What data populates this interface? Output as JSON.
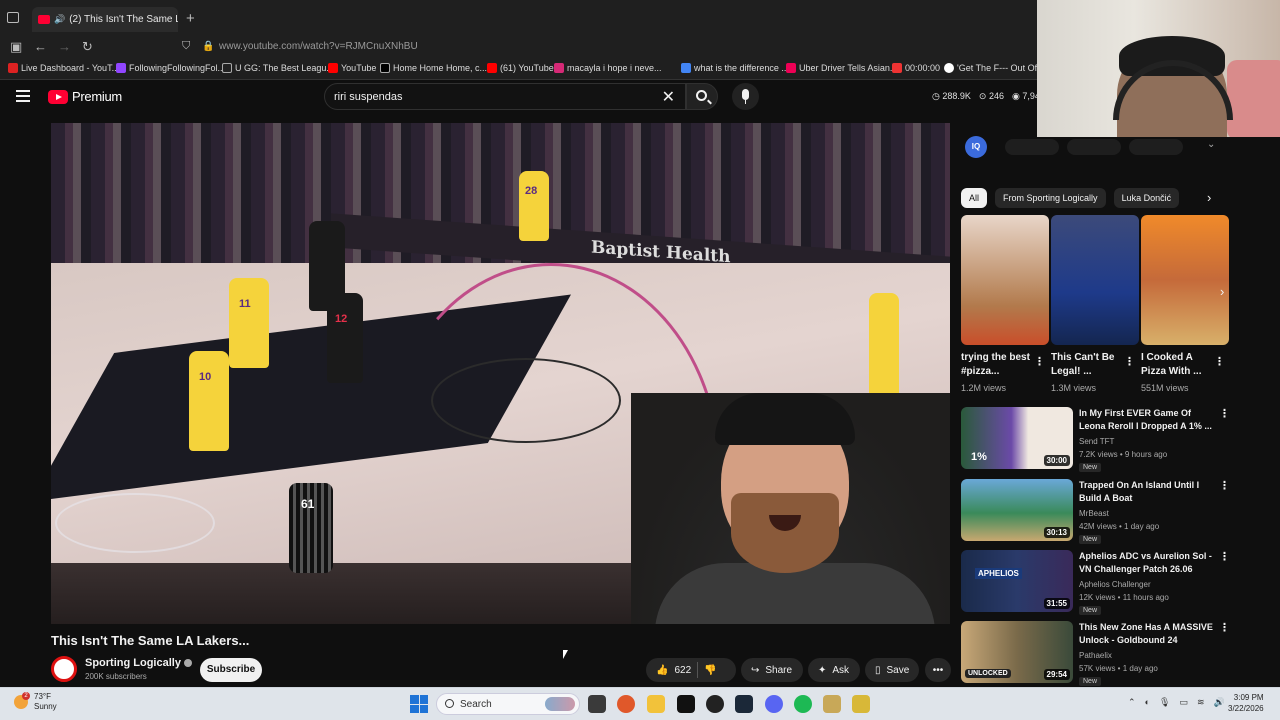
{
  "browser": {
    "tab_title": "(2) This Isn't The Same LA L",
    "url": "www.youtube.com/watch?v=RJMCnuXNhBU",
    "bookmarks": [
      "Live Dashboard - YouT...",
      "FollowingFollowingFol...",
      "U GG: The Best Leagu...",
      "YouTube",
      "Home Home Home, c...",
      "(61) YouTube",
      "macayla i hope i neve...",
      "what is the difference ...",
      "Uber Driver Tells Asian...",
      "00:00:00",
      "'Get The F--- Out Of M"
    ]
  },
  "youtube": {
    "logo_text": "Premium",
    "search_query": "riri suspendas",
    "stats": [
      "288.9K",
      "246",
      "7,94"
    ]
  },
  "video": {
    "title": "This Isn't The Same LA Lakers...",
    "channel": "Sporting Logically",
    "subscribers": "200K subscribers",
    "subscribe_label": "Subscribe",
    "likes": "622",
    "share_label": "Share",
    "ask_label": "Ask",
    "save_label": "Save",
    "court_banner": "Baptist Health",
    "jersey_numbers": [
      "28",
      "11",
      "10",
      "12",
      "61"
    ]
  },
  "sidebar": {
    "iq_label": "IQ",
    "chips": [
      "All",
      "From Sporting Logically",
      "Luka Dončić"
    ],
    "shorts": [
      {
        "title": "trying the best #pizza...",
        "views": "1.2M views"
      },
      {
        "title": "This Can't Be Legal! ...",
        "views": "1.3M views"
      },
      {
        "title": "I Cooked A Pizza With ...",
        "views": "551M views"
      }
    ],
    "recommended": [
      {
        "title": "In My First EVER Game Of Leona Reroll I Dropped A 1% ...",
        "channel": "Send TFT",
        "meta": "7.2K views • 9 hours ago",
        "badge": "New",
        "duration": "30:00"
      },
      {
        "title": "Trapped On An Island Until I Build A Boat",
        "channel": "MrBeast",
        "meta": "42M views • 1 day ago",
        "badge": "New",
        "duration": "30:13"
      },
      {
        "title": "Aphelios ADC vs Aurelion Sol - VN Challenger Patch 26.06",
        "channel": "Aphelios Challenger",
        "meta": "12K views • 11 hours ago",
        "badge": "New",
        "duration": "31:55"
      },
      {
        "title": "This New Zone Has A MASSIVE Unlock - Goldbound 24",
        "channel": "Pathaelix",
        "meta": "57K views • 1 day ago",
        "badge": "New",
        "duration": "29:54"
      }
    ],
    "thumb_labels": [
      "1%",
      "APHELIOS",
      "UNLOCKED"
    ]
  },
  "taskbar": {
    "temperature": "73°F",
    "condition": "Sunny",
    "notification_count": "2",
    "search_label": "Search",
    "time": "3:09 PM",
    "date": "3/22/2026"
  }
}
